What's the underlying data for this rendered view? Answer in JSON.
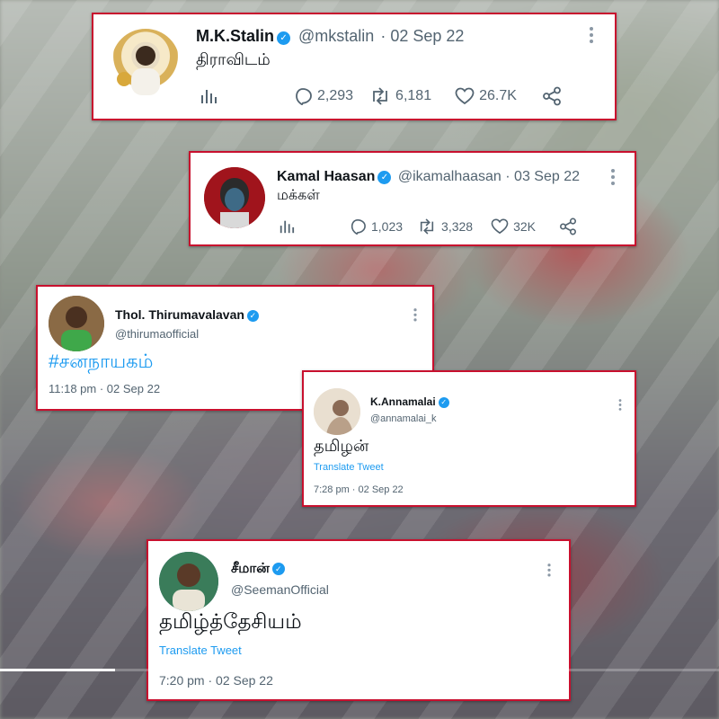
{
  "tweets": {
    "stalin": {
      "name": "M.K.Stalin",
      "handle": "@mkstalin",
      "date": "· 02 Sep 22",
      "text": "திராவிடம்",
      "replies": "2,293",
      "retweets": "6,181",
      "likes": "26.7K"
    },
    "kamal": {
      "name": "Kamal Haasan",
      "handle": "@ikamalhaasan",
      "date": "· 03 Sep 22",
      "text": "மக்கள்",
      "replies": "1,023",
      "retweets": "3,328",
      "likes": "32K"
    },
    "thiruma": {
      "name": "Thol. Thirumavalavan",
      "handle": "@thirumaofficial",
      "text": "#சனநாயகம்",
      "timestamp": "11:18 pm · 02 Sep 22"
    },
    "annamalai": {
      "name": "K.Annamalai",
      "handle": "@annamalai_k",
      "text": "தமிழன்",
      "translate": "Translate Tweet",
      "timestamp": "7:28 pm · 02 Sep 22"
    },
    "seeman": {
      "name": "சீமான்",
      "handle": "@SeemanOfficial",
      "text": "தமிழ்த்தேசியம்",
      "translate": "Translate Tweet",
      "timestamp": "7:20 pm · 02 Sep 22"
    }
  },
  "video": {
    "progress_percent": 16
  },
  "colors": {
    "border": "#c8102e",
    "twitter_blue": "#1d9bf0",
    "muted": "#536471"
  },
  "icons": [
    "verified-badge-icon",
    "more-options-icon",
    "analytics-icon",
    "reply-icon",
    "retweet-icon",
    "like-icon",
    "share-icon"
  ]
}
